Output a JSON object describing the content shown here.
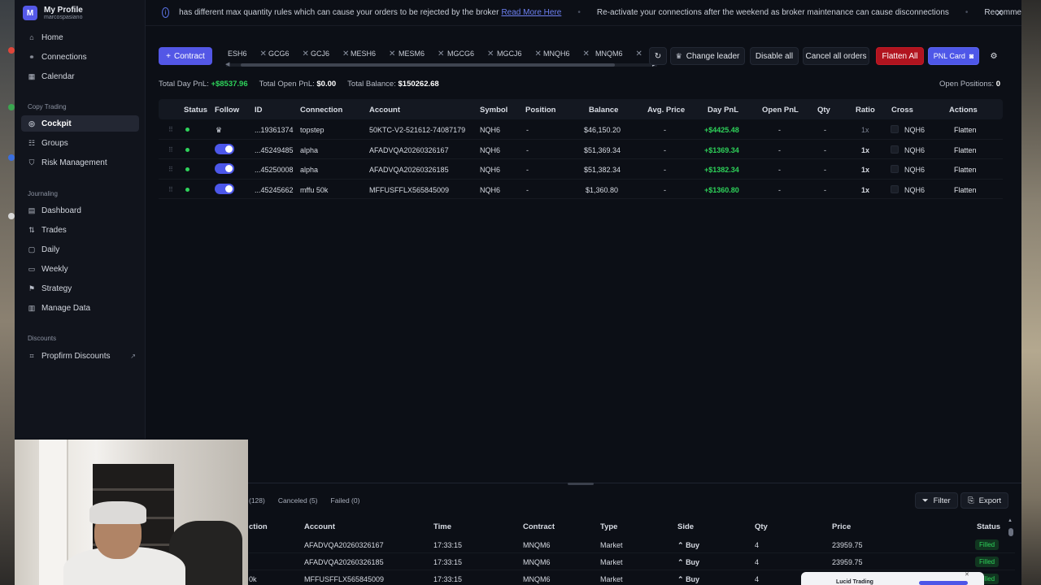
{
  "profile": {
    "initial": "M",
    "name": "My Profile",
    "username": "marcospasiano"
  },
  "sidebar": {
    "items": [
      {
        "label": "Home",
        "icon": "home-icon"
      },
      {
        "label": "Connections",
        "icon": "link-icon"
      },
      {
        "label": "Calendar",
        "icon": "calendar-icon"
      }
    ],
    "section_copy": "Copy Trading",
    "copy_items": [
      {
        "label": "Cockpit",
        "icon": "cockpit-icon",
        "active": true
      },
      {
        "label": "Groups",
        "icon": "groups-icon"
      },
      {
        "label": "Risk Management",
        "icon": "shield-icon"
      }
    ],
    "section_journal": "Journaling",
    "journal_items": [
      {
        "label": "Dashboard",
        "icon": "dashboard-icon"
      },
      {
        "label": "Trades",
        "icon": "trades-icon"
      },
      {
        "label": "Daily",
        "icon": "daily-icon"
      },
      {
        "label": "Weekly",
        "icon": "weekly-icon"
      },
      {
        "label": "Strategy",
        "icon": "strategy-icon"
      },
      {
        "label": "Manage Data",
        "icon": "database-icon"
      }
    ],
    "section_discounts": "Discounts",
    "discount_items": [
      {
        "label": "Propfirm Discounts",
        "icon": "tag-icon"
      }
    ]
  },
  "ticker": {
    "msg1": "has different max quantity rules which can cause your orders to be rejected by the broker",
    "link": "Read More Here",
    "msg2": "Re-activate your connections after the weekend as broker maintenance can cause disconnections",
    "msg3": "Recomme"
  },
  "toolbar": {
    "contract_label": "Contract",
    "contracts": [
      "ESH6",
      "GCG6",
      "GCJ6",
      "MESH6",
      "MESM6",
      "MGCG6",
      "MGCJ6",
      "MNQH6",
      "MNQM6"
    ],
    "change_leader": "Change leader",
    "disable_all": "Disable all",
    "cancel_all": "Cancel all orders",
    "flatten_all": "Flatten All",
    "pnl_card": "PNL Card"
  },
  "totals": {
    "day_pnl_label": "Total Day PnL:",
    "day_pnl": "+$8537.96",
    "open_pnl_label": "Total Open PnL:",
    "open_pnl": "$0.00",
    "balance_label": "Total Balance:",
    "balance": "$150262.68",
    "open_positions_label": "Open Positions:",
    "open_positions": "0"
  },
  "grid": {
    "columns": [
      "Status",
      "Follow",
      "ID",
      "Connection",
      "Account",
      "Symbol",
      "Position",
      "Balance",
      "Avg. Price",
      "Day PnL",
      "Open PnL",
      "Qty",
      "Ratio",
      "Cross",
      "Actions"
    ],
    "rows": [
      {
        "leader": true,
        "id": "...19361374",
        "connection": "topstep",
        "account": "50KTC-V2-521612-74087179",
        "symbol": "NQH6",
        "position": "-",
        "balance": "$46,150.20",
        "avg": "-",
        "day_pnl": "+$4425.48",
        "open_pnl": "-",
        "qty": "-",
        "ratio": "1x",
        "cross": "NQH6",
        "action": "Flatten"
      },
      {
        "leader": false,
        "id": "...45249485",
        "connection": "alpha",
        "account": "AFADVQA20260326167",
        "symbol": "NQH6",
        "position": "-",
        "balance": "$51,369.34",
        "avg": "-",
        "day_pnl": "+$1369.34",
        "open_pnl": "-",
        "qty": "-",
        "ratio": "1x",
        "cross": "NQH6",
        "action": "Flatten"
      },
      {
        "leader": false,
        "id": "...45250008",
        "connection": "alpha",
        "account": "AFADVQA20260326185",
        "symbol": "NQH6",
        "position": "-",
        "balance": "$51,382.34",
        "avg": "-",
        "day_pnl": "+$1382.34",
        "open_pnl": "-",
        "qty": "-",
        "ratio": "1x",
        "cross": "NQH6",
        "action": "Flatten"
      },
      {
        "leader": false,
        "id": "...45245662",
        "connection": "mffu 50k",
        "account": "MFFUSFFLX565845009",
        "symbol": "NQH6",
        "position": "-",
        "balance": "$1,360.80",
        "avg": "-",
        "day_pnl": "+$1360.80",
        "open_pnl": "-",
        "qty": "-",
        "ratio": "1x",
        "cross": "NQH6",
        "action": "Flatten"
      }
    ]
  },
  "orders": {
    "tab_filled": "(128)",
    "tab_canceled": "Canceled (5)",
    "tab_failed": "Failed (0)",
    "filter": "Filter",
    "export": "Export",
    "columns": [
      "ction",
      "Account",
      "Time",
      "Contract",
      "Type",
      "Side",
      "Qty",
      "Price",
      "Status"
    ],
    "rows": [
      {
        "conn": "",
        "account": "AFADVQA20260326167",
        "time": "17:33:15",
        "contract": "MNQM6",
        "type": "Market",
        "side": "Buy",
        "qty": "4",
        "price": "23959.75",
        "status": "Filled"
      },
      {
        "conn": "",
        "account": "AFADVQA20260326185",
        "time": "17:33:15",
        "contract": "MNQM6",
        "type": "Market",
        "side": "Buy",
        "qty": "4",
        "price": "23959.75",
        "status": "Filled"
      },
      {
        "conn": "0k",
        "account": "MFFUSFFLX565845009",
        "time": "17:33:15",
        "contract": "MNQM6",
        "type": "Market",
        "side": "Buy",
        "qty": "4",
        "price": "",
        "status": "Filled"
      }
    ]
  },
  "toast": {
    "title": "Lucid Trading"
  },
  "colors": {
    "accent": "#5357e6",
    "positive": "#2ed25a",
    "danger": "#b1141f",
    "leader": "#e9b72c"
  }
}
